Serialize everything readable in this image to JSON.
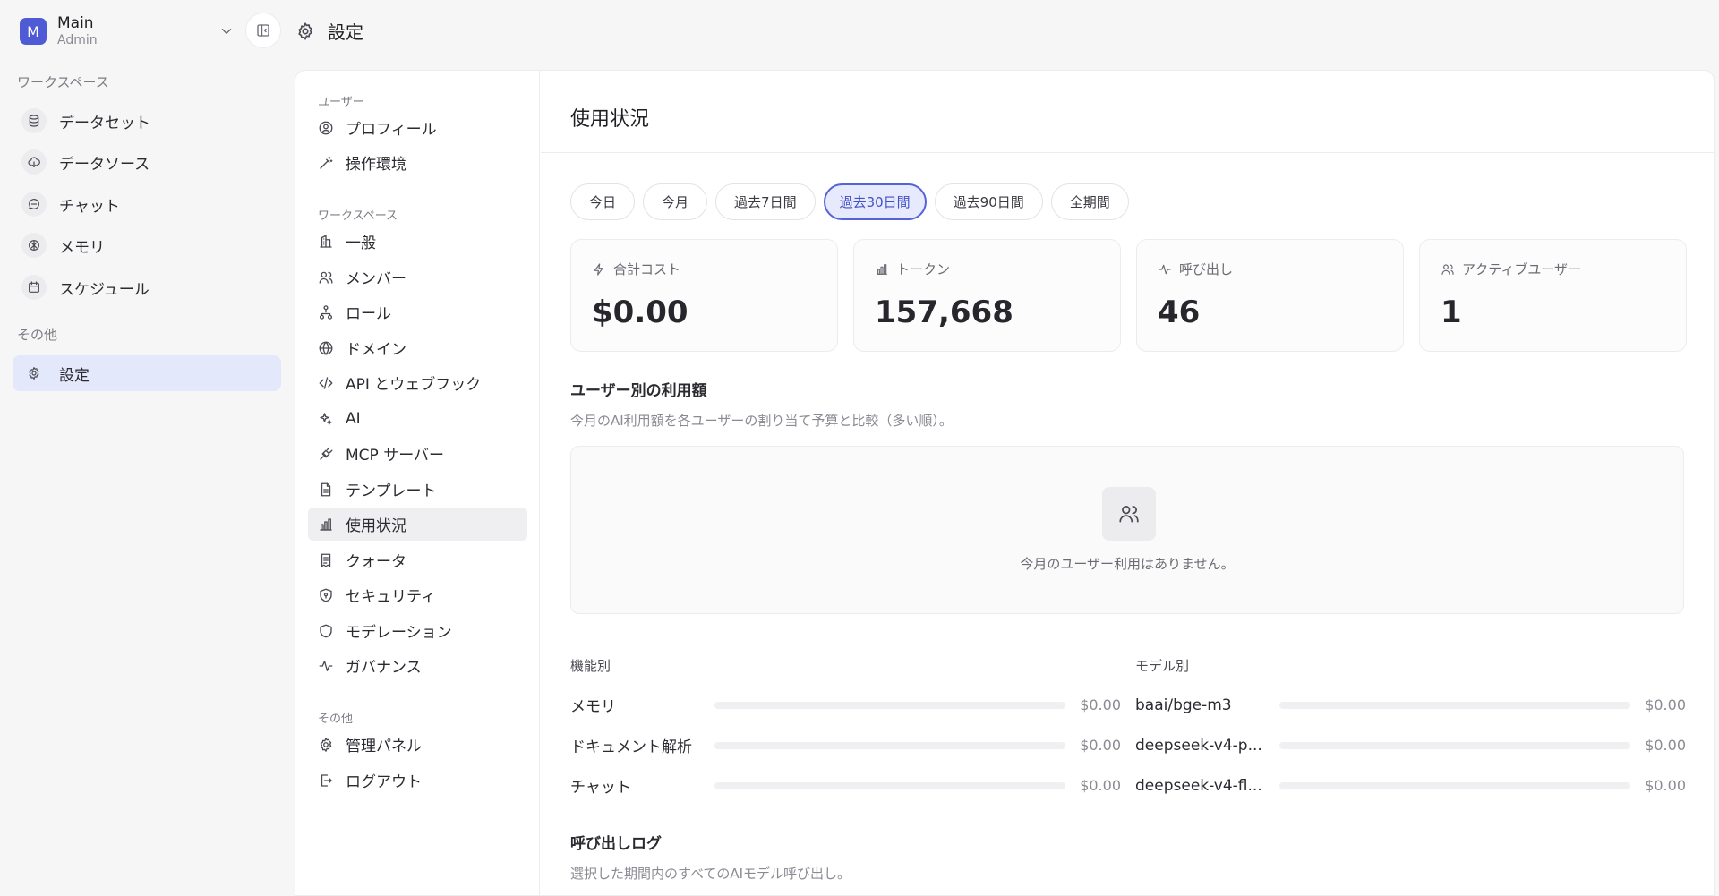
{
  "workspace": {
    "initial": "M",
    "name": "Main",
    "role": "Admin"
  },
  "header": {
    "title": "設定"
  },
  "sidebar": {
    "section_workspace": "ワークスペース",
    "section_other": "その他",
    "items": [
      {
        "label": "データセット",
        "icon": "database-icon"
      },
      {
        "label": "データソース",
        "icon": "cloud-download-icon"
      },
      {
        "label": "チャット",
        "icon": "chat-icon"
      },
      {
        "label": "メモリ",
        "icon": "brain-icon"
      },
      {
        "label": "スケジュール",
        "icon": "calendar-icon"
      }
    ],
    "settings_label": "設定"
  },
  "settings_nav": {
    "section_user": "ユーザー",
    "section_workspace": "ワークスペース",
    "section_other": "その他",
    "user_items": [
      {
        "label": "プロフィール",
        "icon": "user-circle-icon"
      },
      {
        "label": "操作環境",
        "icon": "wand-icon"
      }
    ],
    "workspace_items": [
      {
        "label": "一般",
        "icon": "building-icon"
      },
      {
        "label": "メンバー",
        "icon": "users-icon"
      },
      {
        "label": "ロール",
        "icon": "hierarchy-icon"
      },
      {
        "label": "ドメイン",
        "icon": "globe-icon"
      },
      {
        "label": "API とウェブフック",
        "icon": "code-icon"
      },
      {
        "label": "AI",
        "icon": "sparkles-icon"
      },
      {
        "label": "MCP サーバー",
        "icon": "plug-icon"
      },
      {
        "label": "テンプレート",
        "icon": "file-icon"
      },
      {
        "label": "使用状況",
        "icon": "bar-chart-icon"
      },
      {
        "label": "クォータ",
        "icon": "receipt-icon"
      },
      {
        "label": "セキュリティ",
        "icon": "shield-lock-icon"
      },
      {
        "label": "モデレーション",
        "icon": "shield-icon"
      },
      {
        "label": "ガバナンス",
        "icon": "activity-icon"
      }
    ],
    "other_items": [
      {
        "label": "管理パネル",
        "icon": "gear-icon"
      },
      {
        "label": "ログアウト",
        "icon": "logout-icon"
      }
    ]
  },
  "usage": {
    "title": "使用状況",
    "ranges": [
      "今日",
      "今月",
      "過去7日間",
      "過去30日間",
      "過去90日間",
      "全期間"
    ],
    "active_range": "過去30日間",
    "stats": [
      {
        "label": "合計コスト",
        "value": "$0.00",
        "icon": "bolt-icon"
      },
      {
        "label": "トークン",
        "value": "157,668",
        "icon": "bar-chart-icon"
      },
      {
        "label": "呼び出し",
        "value": "46",
        "icon": "activity-icon"
      },
      {
        "label": "アクティブユーザー",
        "value": "1",
        "icon": "users-icon"
      }
    ],
    "per_user_title": "ユーザー別の利用額",
    "per_user_subtitle": "今月のAI利用額を各ユーザーの割り当て予算と比較（多い順）。",
    "per_user_empty": "今月のユーザー利用はありません。",
    "by_feature_title": "機能別",
    "by_feature": [
      {
        "label": "メモリ",
        "value": "$0.00",
        "fraction": 0
      },
      {
        "label": "ドキュメント解析",
        "value": "$0.00",
        "fraction": 0
      },
      {
        "label": "チャット",
        "value": "$0.00",
        "fraction": 0
      }
    ],
    "by_model_title": "モデル別",
    "by_model": [
      {
        "label": "baai/bge-m3",
        "value": "$0.00",
        "fraction": 0
      },
      {
        "label": "deepseek-v4-p...",
        "value": "$0.00",
        "fraction": 0
      },
      {
        "label": "deepseek-v4-fl...",
        "value": "$0.00",
        "fraction": 0
      }
    ],
    "call_log_title": "呼び出しログ",
    "call_log_subtitle": "選択した期間内のすべてのAIモデル呼び出し。"
  },
  "colors": {
    "accent": "#5563d8",
    "accent_bg": "#e6eafc",
    "avatar": "#4f5bd5"
  }
}
